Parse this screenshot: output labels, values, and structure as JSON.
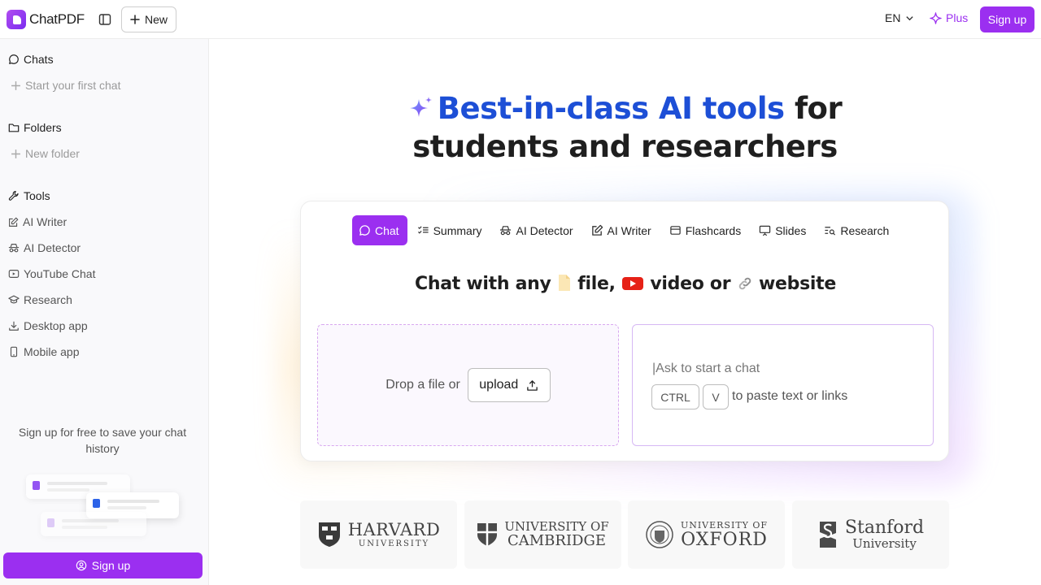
{
  "header": {
    "brand": "ChatPDF",
    "new_label": "New",
    "lang_label": "EN",
    "plus_label": "Plus",
    "signup_label": "Sign up",
    "accent_color": "#9b2ff0"
  },
  "sidebar": {
    "chats_label": "Chats",
    "start_chat_label": "Start your first chat",
    "folders_label": "Folders",
    "new_folder_label": "New folder",
    "tools_label": "Tools",
    "tools": [
      {
        "label": "AI Writer",
        "icon": "pencil-square-icon"
      },
      {
        "label": "AI Detector",
        "icon": "detective-icon"
      },
      {
        "label": "YouTube Chat",
        "icon": "play-square-icon"
      },
      {
        "label": "Research",
        "icon": "graduation-cap-icon"
      },
      {
        "label": "Desktop app",
        "icon": "download-icon"
      },
      {
        "label": "Mobile app",
        "icon": "phone-icon"
      }
    ],
    "note": "Sign up for free to save your chat history",
    "signup_label": "Sign up"
  },
  "hero": {
    "highlight": "Best-in-class AI tools",
    "rest_line1": " for",
    "line2": "students and researchers",
    "highlight_color": "#1d4fd6"
  },
  "card": {
    "tabs": [
      {
        "label": "Chat",
        "icon": "chat-bubble-icon",
        "active": true
      },
      {
        "label": "Summary",
        "icon": "checklist-icon",
        "active": false
      },
      {
        "label": "AI Detector",
        "icon": "detective-icon",
        "active": false
      },
      {
        "label": "AI Writer",
        "icon": "pencil-square-icon",
        "active": false
      },
      {
        "label": "Flashcards",
        "icon": "flashcard-icon",
        "active": false
      },
      {
        "label": "Slides",
        "icon": "presentation-icon",
        "active": false
      },
      {
        "label": "Research",
        "icon": "search-list-icon",
        "active": false
      }
    ],
    "title_parts": {
      "p1": "Chat with any ",
      "p2": " file, ",
      "p3": " video or ",
      "p4": " website"
    },
    "drop_text": "Drop a file or",
    "upload_label": "upload",
    "chat_placeholder": "Ask to start a chat",
    "kbd_ctrl": "CTRL",
    "kbd_v": "V",
    "paste_hint": "to paste text or links"
  },
  "universities": [
    {
      "line1": "HARVARD",
      "line2": "UNIVERSITY"
    },
    {
      "line1": "UNIVERSITY OF",
      "line2": "CAMBRIDGE"
    },
    {
      "line1": "UNIVERSITY OF",
      "line2": "OXFORD"
    },
    {
      "line1": "Stanford",
      "line2": "University"
    }
  ]
}
